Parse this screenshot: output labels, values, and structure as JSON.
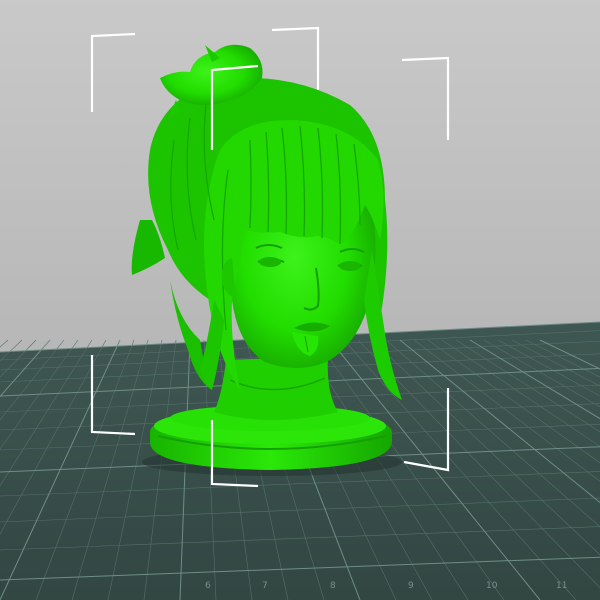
{
  "viewport": {
    "background_top_color": "#c6c6c6",
    "background_bottom_color": "#aeaeae",
    "bed_color": "#3b524d",
    "bed_grid_color": "#55706a",
    "bed_major_grid_color": "#6c8a83",
    "model_color": "#22dd00",
    "model_shadow_color": "#14a000",
    "bracket_color": "#ffffff",
    "bed_ruler_labels": [
      "6",
      "7",
      "8",
      "9",
      "10",
      "11"
    ]
  }
}
